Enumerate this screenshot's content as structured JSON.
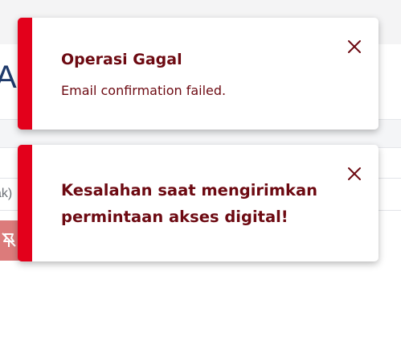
{
  "background": {
    "title_fragment": "Ak",
    "field_fragment": "ak)"
  },
  "toasts": [
    {
      "title": "Operasi Gagal",
      "message": "Email confirmation failed.",
      "close_icon": "close-icon"
    },
    {
      "title": "Kesalahan saat mengirimkan permintaan akses digital!",
      "close_icon": "close-icon"
    }
  ],
  "colors": {
    "accent": "#e3001b",
    "text": "#6d0a12",
    "page_title": "#1f3a6b",
    "bg_button": "#dc7b7b"
  }
}
